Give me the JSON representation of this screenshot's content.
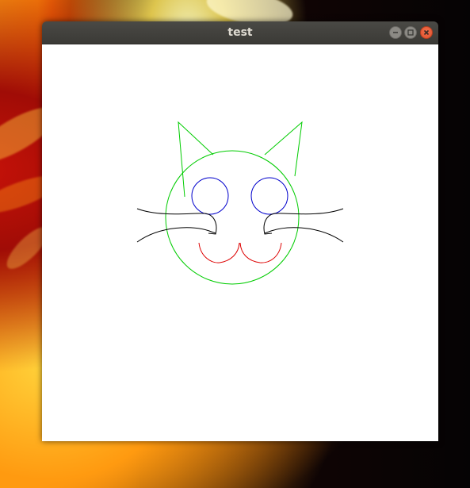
{
  "window": {
    "title": "test",
    "buttons": {
      "minimize_icon": "minimize-icon",
      "maximize_icon": "maximize-icon",
      "close_icon": "close-icon"
    }
  },
  "drawing": {
    "colors": {
      "head": "#00cc00",
      "eyes": "#0000cc",
      "mouth": "#dd0000",
      "whiskers": "#000000",
      "background": "#ffffff"
    }
  }
}
